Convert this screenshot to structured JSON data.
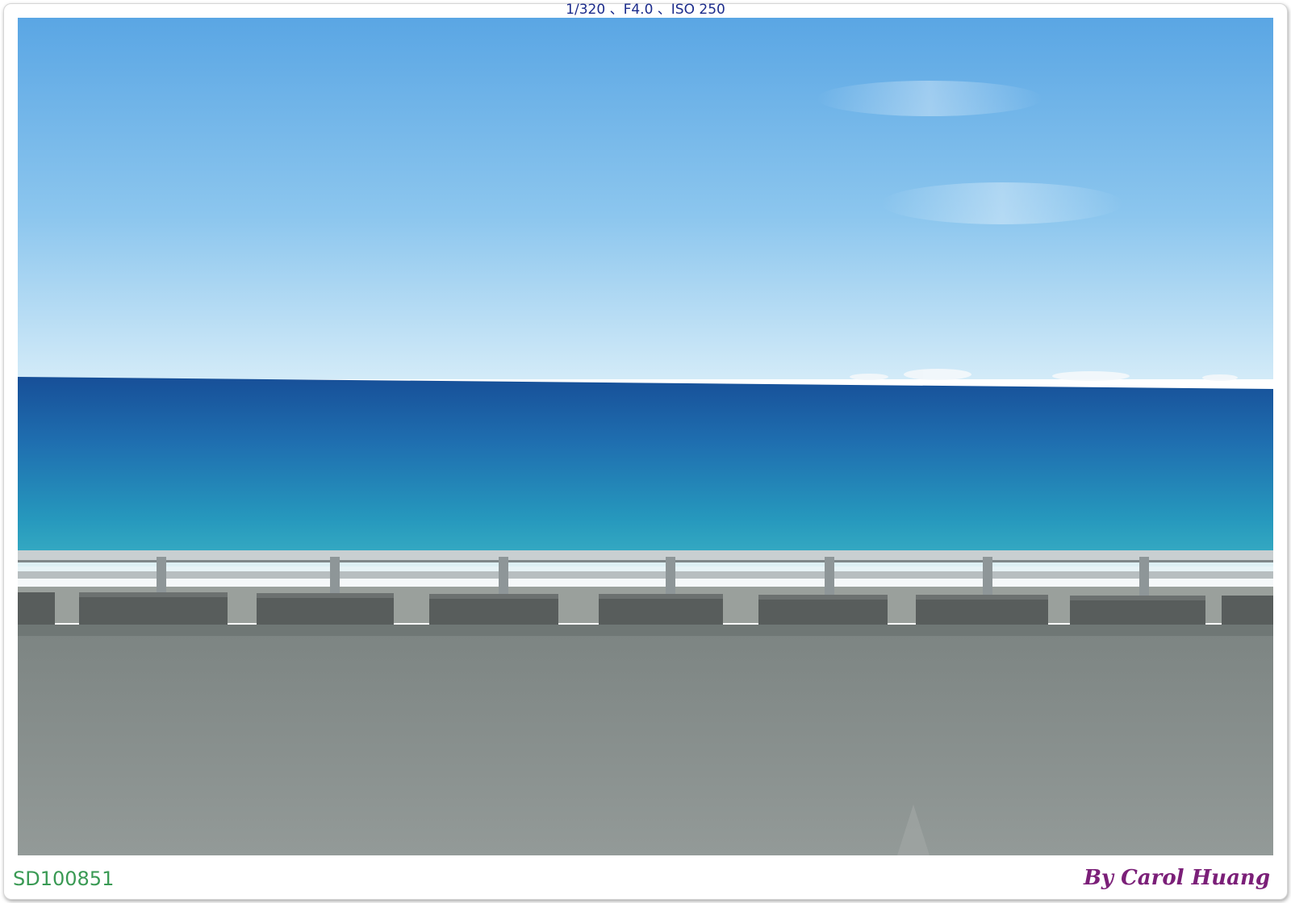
{
  "exif_caption": "1/320 、F4.0 、ISO 250",
  "photo_id": "SD100851",
  "signature": "By Carol Huang",
  "scene": {
    "subject_icon": "photo-coastal-road-sea-view",
    "colors": {
      "sky_top": "#5ea8e4",
      "sky_horizon": "#d6ecf8",
      "sea_far": "#1c5ea6",
      "sea_near": "#2ea6c0",
      "surf": "#f2f8fa",
      "road": "#8c9390",
      "barrier": "#5a5f5e",
      "rail": "#bfc6c8"
    }
  },
  "colors": {
    "exif_text": "#1c2c8c",
    "id_text": "#3a9a54",
    "signature_text": "#7b1f78"
  }
}
